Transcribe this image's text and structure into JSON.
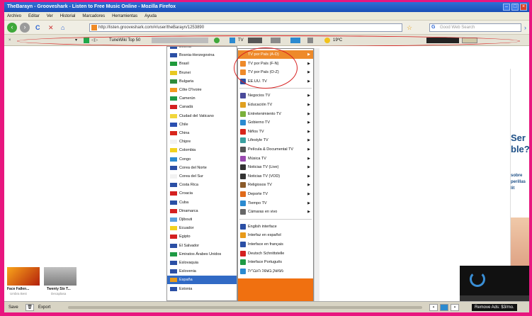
{
  "window": {
    "title": "TheBarayn - Grooveshark - Listen to Free Music Online - Mozilla Firefox"
  },
  "menubar": [
    "Archivo",
    "Editar",
    "Ver",
    "Historial",
    "Marcadores",
    "Herramientas",
    "Ayuda"
  ],
  "navbar": {
    "url": "http://listen.grooveshark.com/#/user/theBarayn/1253890",
    "search_placeholder": "Good Web Search"
  },
  "toolbar": {
    "top50": "TuneWiki Top 50",
    "tv": "TV",
    "weather": "19ºC"
  },
  "countries": [
    {
      "label": "Bosnia",
      "color": "#2b4fa5"
    },
    {
      "label": "Bosnia-Herzegovina",
      "color": "#2b4fa5"
    },
    {
      "label": "Brasil",
      "color": "#1f9a3a"
    },
    {
      "label": "Brunei",
      "color": "#e8c822"
    },
    {
      "label": "Bulgaria",
      "color": "#2e8b3a"
    },
    {
      "label": "Côte D'Ivoire",
      "color": "#f39a1e"
    },
    {
      "label": "Camerún",
      "color": "#1e9a44"
    },
    {
      "label": "Canadá",
      "color": "#d42020"
    },
    {
      "label": "Ciudad del Vaticano",
      "color": "#f1d63b"
    },
    {
      "label": "Chile",
      "color": "#2a4fb0"
    },
    {
      "label": "China",
      "color": "#d8261c"
    },
    {
      "label": "Chipre",
      "color": "#f2f2f2"
    },
    {
      "label": "Colombia",
      "color": "#f2d21e"
    },
    {
      "label": "Congo",
      "color": "#2b8ad0"
    },
    {
      "label": "Corea del Norte",
      "color": "#2b4fa5"
    },
    {
      "label": "Corea del Sur",
      "color": "#f2f2f2"
    },
    {
      "label": "Costa Rica",
      "color": "#2b4fa5"
    },
    {
      "label": "Croacia",
      "color": "#d42020"
    },
    {
      "label": "Cuba",
      "color": "#2b4fa5"
    },
    {
      "label": "Dinamarca",
      "color": "#d42020"
    },
    {
      "label": "Djibouti",
      "color": "#5aa0dc"
    },
    {
      "label": "Ecuador",
      "color": "#f2d21e"
    },
    {
      "label": "Egipto",
      "color": "#d42020"
    },
    {
      "label": "El Salvador",
      "color": "#2b4fa5"
    },
    {
      "label": "Emiratos Árabes Unidos",
      "color": "#1e9a44"
    },
    {
      "label": "Eslovaquia",
      "color": "#2b4fa5"
    },
    {
      "label": "Eslovenia",
      "color": "#2b4fa5"
    },
    {
      "label": "España",
      "color": "#e89a1a"
    },
    {
      "label": "Estonia",
      "color": "#2b4fa5"
    }
  ],
  "selected_country": "España",
  "menu": [
    {
      "label": "TV por País (A-D)",
      "color": "#ee8a2a",
      "sel": true
    },
    {
      "label": "TV por País (F-N)",
      "color": "#ee8a2a"
    },
    {
      "label": "TV por País (O-Z)",
      "color": "#ee8a2a"
    },
    {
      "label": "EE.UU. TV",
      "color": "#2b4fa5"
    },
    {
      "sep": true
    },
    {
      "label": "Negocios TV",
      "color": "#4a4a9a"
    },
    {
      "label": "Educación TV",
      "color": "#e0a020"
    },
    {
      "label": "Entretenimiento TV",
      "color": "#7ab03a"
    },
    {
      "label": "Gobierno TV",
      "color": "#2b8ad0"
    },
    {
      "label": "Niños TV",
      "color": "#d8261c"
    },
    {
      "label": "Lifestyle TV",
      "color": "#3aa0a0"
    },
    {
      "label": "Película & Documental TV",
      "color": "#555"
    },
    {
      "label": "Música TV",
      "color": "#9a4ab0"
    },
    {
      "label": "Noticias TV (Live)",
      "color": "#333"
    },
    {
      "label": "Noticias TV (VOD)",
      "color": "#333"
    },
    {
      "label": "Religiosos TV",
      "color": "#8a5a2a"
    },
    {
      "label": "Deporte TV",
      "color": "#e06a1a"
    },
    {
      "label": "Tiempo TV",
      "color": "#2b8ad0"
    },
    {
      "label": "Cámaras en vivo",
      "color": "#666"
    },
    {
      "sep": true
    },
    {
      "label": "English interface",
      "color": "#2b4fa5"
    },
    {
      "label": "Interfaz en español",
      "color": "#e89a1a"
    },
    {
      "label": "Interface en français",
      "color": "#2b4fa5"
    },
    {
      "label": "Deutsch Schnittstelle",
      "color": "#d42020"
    },
    {
      "label": "Interface Português",
      "color": "#1e9a44"
    },
    {
      "label": "ממשק בשפה העברית",
      "color": "#2b8ad0"
    }
  ],
  "rightad": {
    "big": "Ser ble?",
    "small": "sobre perillas lit"
  },
  "thumbs": [
    {
      "title": "Face Fallen...",
      "sub": "Umbra Best"
    },
    {
      "title": "Twenty Six T...",
      "sub": "Decaplasa"
    }
  ],
  "statusbar": {
    "save": "Save",
    "export": "Export",
    "player_text": "Remove Ads: $3/mo."
  }
}
